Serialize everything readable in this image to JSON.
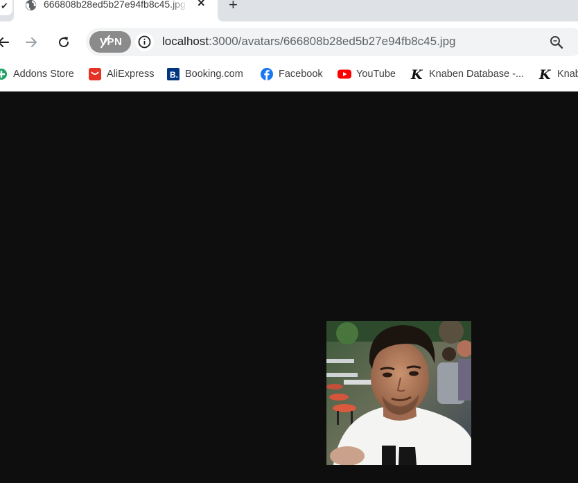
{
  "tab": {
    "title": "666808b28ed5b27e94fb8c45.jpg",
    "close_glyph": "×",
    "new_tab_glyph": "+",
    "favicon": "globe-icon"
  },
  "toolbar": {
    "vpn_label": "VPN",
    "url_host": "localhost",
    "url_path": ":3000/avatars/666808b28ed5b27e94fb8c45.jpg",
    "icons": [
      "back-arrow-icon",
      "forward-arrow-icon",
      "reload-icon",
      "info-icon",
      "zoom-icon"
    ]
  },
  "bookmarks": [
    {
      "label": "Addons Store",
      "icon": "addons-icon",
      "color": "#1ea362"
    },
    {
      "label": "AliExpress",
      "icon": "aliexpress-icon",
      "color": "#e43225"
    },
    {
      "label": "Booking.com",
      "icon": "booking-icon",
      "color": "#003580"
    },
    {
      "label": "Facebook",
      "icon": "facebook-icon",
      "color": "#1877f2"
    },
    {
      "label": "YouTube",
      "icon": "youtube-icon",
      "color": "#ff0000"
    },
    {
      "label": "Knaben Database -...",
      "icon": "knaben-icon",
      "color": "#111111"
    },
    {
      "label": "Knab",
      "icon": "knaben-icon",
      "color": "#111111"
    }
  ],
  "content": {
    "background": "#0e0e0e",
    "image": "avatar-photo"
  }
}
